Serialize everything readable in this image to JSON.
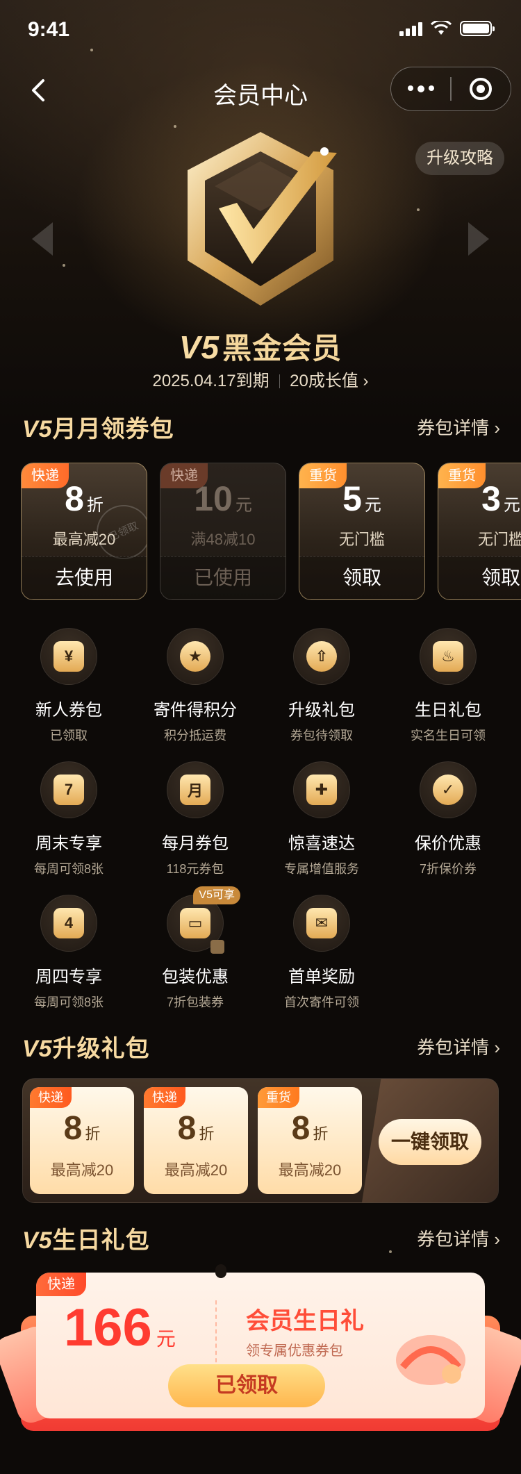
{
  "status": {
    "time": "9:41"
  },
  "nav": {
    "title": "会员中心"
  },
  "hero": {
    "strategy": "升级攻略",
    "level_code": "V5",
    "level_name": "黑金会员",
    "expire": "2025.04.17到期",
    "growth": "20成长值",
    "growth_arrow": "›"
  },
  "monthly": {
    "title_code": "V5",
    "title_text": "月月领券包",
    "link": "券包详情 ›",
    "coupons": [
      {
        "tag": "快递",
        "num": "8",
        "unit": "折",
        "desc": "最高减20",
        "btn": "去使用",
        "stamp": "已领取",
        "state": "active"
      },
      {
        "tag": "快递",
        "num": "10",
        "unit": "元",
        "desc": "满48减10",
        "btn": "已使用",
        "state": "used"
      },
      {
        "tag": "重货",
        "num": "5",
        "unit": "元",
        "desc": "无门槛",
        "btn": "领取",
        "state": "active"
      },
      {
        "tag": "重货",
        "num": "3",
        "unit": "元",
        "desc": "无门槛",
        "btn": "领取",
        "state": "active"
      }
    ]
  },
  "benefits": [
    {
      "name": "新人券包",
      "sub": "已领取",
      "icon": "coupon-yen-icon",
      "glyph": "¥"
    },
    {
      "name": "寄件得积分",
      "sub": "积分抵运费",
      "icon": "star-points-icon",
      "glyph": "★"
    },
    {
      "name": "升级礼包",
      "sub": "券包待领取",
      "icon": "upgrade-bag-icon",
      "glyph": "⇧"
    },
    {
      "name": "生日礼包",
      "sub": "实名生日可领",
      "icon": "birthday-cake-icon",
      "glyph": "♨"
    },
    {
      "name": "周末专享",
      "sub": "每周可领8张",
      "icon": "calendar-7-icon",
      "glyph": "7"
    },
    {
      "name": "每月券包",
      "sub": "118元券包",
      "icon": "monthly-ticket-icon",
      "glyph": "月"
    },
    {
      "name": "惊喜速达",
      "sub": "专属增值服务",
      "icon": "gift-box-icon",
      "glyph": "✚"
    },
    {
      "name": "保价优惠",
      "sub": "7折保价券",
      "icon": "shield-check-icon",
      "glyph": "✓"
    },
    {
      "name": "周四专享",
      "sub": "每周可领8张",
      "icon": "calendar-4-icon",
      "glyph": "4"
    },
    {
      "name": "包装优惠",
      "sub": "7折包装券",
      "icon": "package-box-icon",
      "glyph": "▭",
      "tag": "V5可享",
      "locked": true
    },
    {
      "name": "首单奖励",
      "sub": "首次寄件可领",
      "icon": "envelope-reward-icon",
      "glyph": "✉"
    }
  ],
  "upgrade": {
    "title_code": "V5",
    "title_text": "升级礼包",
    "link": "券包详情 ›",
    "coupons": [
      {
        "tag": "快递",
        "num": "8",
        "unit": "折",
        "desc": "最高减20"
      },
      {
        "tag": "快递",
        "num": "8",
        "unit": "折",
        "desc": "最高减20"
      },
      {
        "tag": "重货",
        "num": "8",
        "unit": "折",
        "desc": "最高减20"
      }
    ],
    "get_all": "一键领取"
  },
  "birthday": {
    "title_code": "V5",
    "title_text": "生日礼包",
    "link": "券包详情 ›",
    "tag": "快递",
    "amount": "166",
    "unit": "元",
    "card_title": "会员生日礼",
    "card_sub": "领专属优惠券包",
    "btn": "已领取"
  }
}
